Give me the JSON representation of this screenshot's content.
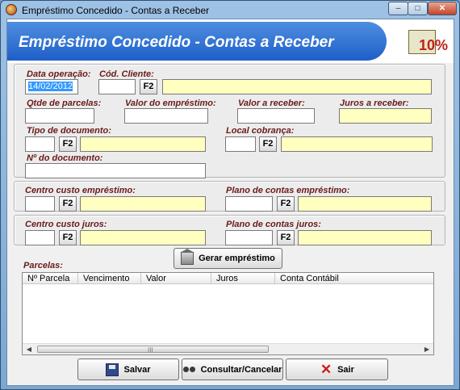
{
  "window": {
    "title": "Empréstimo Concedido - Contas a Receber",
    "min_glyph": "–",
    "max_glyph": "□",
    "close_glyph": "✕"
  },
  "header": {
    "title": "Empréstimo Concedido - Contas a Receber",
    "logo_text": "10%"
  },
  "form": {
    "data_operacao": {
      "label": "Data operação:",
      "value": "14/02/2012"
    },
    "cod_cliente": {
      "label": "Cód. Cliente:",
      "value": "",
      "f2": "F2",
      "name_value": ""
    },
    "qtde_parcelas": {
      "label": "Qtde de parcelas:",
      "value": ""
    },
    "valor_emprestimo": {
      "label": "Valor do empréstimo:",
      "value": ""
    },
    "valor_receber": {
      "label": "Valor a receber:",
      "value": ""
    },
    "juros_receber": {
      "label": "Juros a receber:",
      "value": ""
    },
    "tipo_documento": {
      "label": "Tipo de documento:",
      "code": "",
      "f2": "F2",
      "desc": ""
    },
    "local_cobranca": {
      "label": "Local cobrança:",
      "code": "",
      "f2": "F2",
      "desc": ""
    },
    "num_documento": {
      "label": "Nº do documento:",
      "value": ""
    },
    "centro_custo_emprestimo": {
      "label": "Centro custo empréstimo:",
      "code": "",
      "f2": "F2",
      "desc": ""
    },
    "plano_contas_emprestimo": {
      "label": "Plano de contas empréstimo:",
      "code": "",
      "f2": "F2",
      "desc": ""
    },
    "centro_custo_juros": {
      "label": "Centro custo juros:",
      "code": "",
      "f2": "F2",
      "desc": ""
    },
    "plano_contas_juros": {
      "label": "Plano de contas juros:",
      "code": "",
      "f2": "F2",
      "desc": ""
    }
  },
  "gerar_button": {
    "label": "Gerar empréstimo",
    "icon": "bank-icon"
  },
  "parcelas": {
    "label": "Parcelas:",
    "columns": [
      "Nº Parcela",
      "Vencimento",
      "Valor",
      "Juros",
      "Conta Contábil"
    ],
    "rows": [],
    "scroll_left": "◀",
    "scroll_right": "▶",
    "grip": "III"
  },
  "footer": {
    "save_label": "Salvar",
    "consult_label": "Consultar/Cancelar",
    "exit_label": "Sair"
  },
  "colors": {
    "header_blue": "#1f5ec8",
    "label_red": "#6a1a1a",
    "lookup_yellow": "#ffffc0"
  }
}
